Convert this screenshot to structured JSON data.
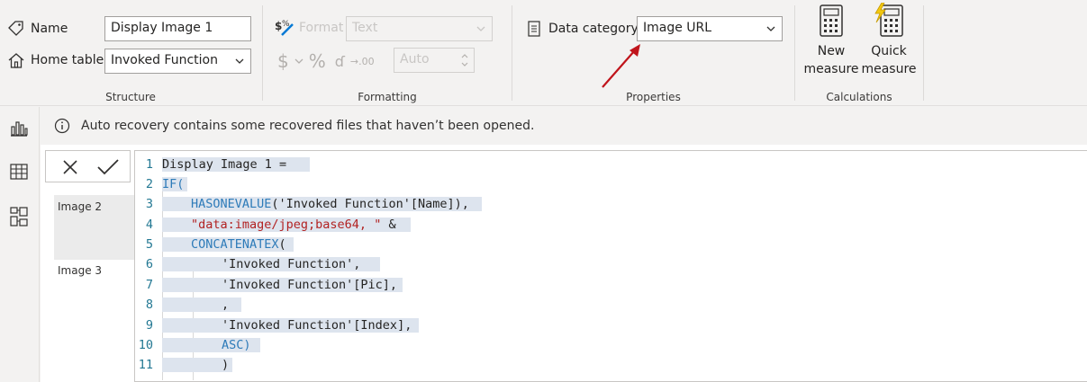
{
  "structure": {
    "name_label": "Name",
    "name_value": "Display Image 1",
    "home_table_label": "Home table",
    "home_table_value": "Invoked Function",
    "group_label": "Structure"
  },
  "formatting": {
    "format_label": "Format",
    "format_value": "Text",
    "currency_symbol": "$",
    "percent_symbol": "%",
    "comma_symbol": "ɗ",
    "decimal_symbol": "→.00",
    "decimals_value": "Auto",
    "group_label": "Formatting"
  },
  "properties": {
    "data_category_label": "Data category",
    "data_category_value": "Image URL",
    "group_label": "Properties"
  },
  "calculations": {
    "new_measure_line1": "New",
    "new_measure_line2": "measure",
    "quick_measure_line1": "Quick",
    "quick_measure_line2": "measure",
    "group_label": "Calculations"
  },
  "infobar": {
    "message": "Auto recovery contains some recovered files that haven’t been opened."
  },
  "table_rows": [
    "Image 2",
    "Image 3"
  ],
  "editor": {
    "line_numbers": [
      "1",
      "2",
      "3",
      "4",
      "5",
      "6",
      "7",
      "8",
      "9",
      "10",
      "11"
    ],
    "lines": [
      "Display Image 1 = ",
      "IF(",
      "HASONEVALUE('Invoked Function'[Name]),",
      "\"data:image/jpeg;base64, \" &",
      "CONCATENATEX(",
      "'Invoked Function',",
      "'Invoked Function'[Pic],",
      ",",
      "'Invoked Function'[Index],",
      "ASC)",
      ")"
    ]
  },
  "colors": {
    "keyword": "#2e7bb9",
    "string": "#b22222",
    "arrow": "#c0141b",
    "highlight": "#dde4ee"
  }
}
